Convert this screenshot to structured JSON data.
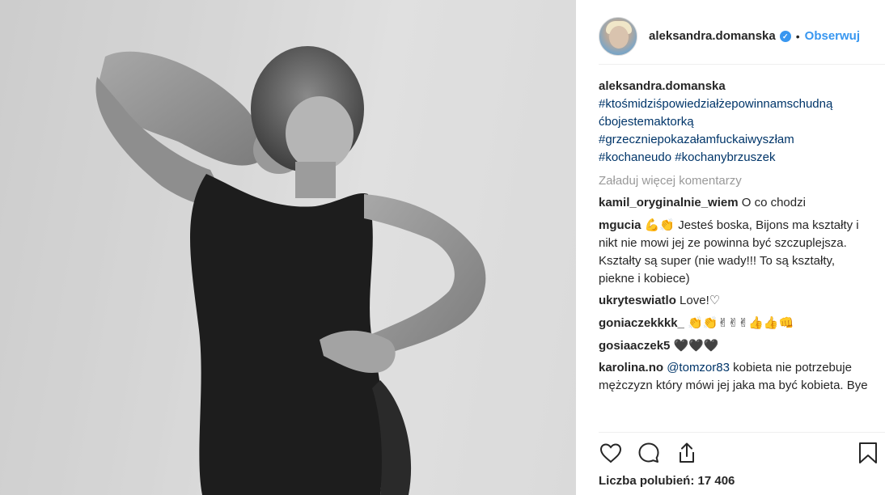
{
  "post": {
    "username": "aleksandra.domanska",
    "verified_symbol": "✓",
    "separator": "•",
    "follow_label": "Obserwuj"
  },
  "caption": {
    "username": "aleksandra.domanska",
    "hashtags": [
      "#ktośmidziśpowiedziałżepowinnamschudną",
      "ćbojestemaktorką",
      "#grzeczniepokazałamfuckaiwyszłam",
      "#kochaneudo #kochanybrzuszek"
    ]
  },
  "load_more_label": "Załaduj więcej komentarzy",
  "comments": [
    {
      "user": "kamil_oryginalnie_wiem",
      "text": "O co chodzi"
    },
    {
      "user": "mgucia",
      "emoji": "💪👏",
      "text": " Jesteś boska, Bijons ma kształty i nikt nie mowi jej ze powinna być szczuplejsza. Kształty są super (nie wady!!! To są kształty, piekne i kobiece)"
    },
    {
      "user": "ukryteswiatlo",
      "text": "Love!♡"
    },
    {
      "user": "goniaczekkkk_",
      "emoji": "👏👏✌✌✌👍👍👊"
    },
    {
      "user": "gosiaaczek5",
      "emoji": "🖤🖤🖤"
    },
    {
      "user": "karolina.no",
      "mention": "@tomzor83",
      "text": " kobieta nie potrzebuje mężczyzn który mówi jej jaka ma być kobieta. Bye"
    }
  ],
  "actions": {
    "like_icon": "heart-icon",
    "comment_icon": "comment-bubble-icon",
    "share_icon": "share-icon",
    "save_icon": "bookmark-icon"
  },
  "likes_label": "Liczba polubień: 17 406",
  "colors": {
    "link": "#3897f0",
    "hashtag": "#003569",
    "muted": "#999999",
    "text": "#262626"
  }
}
